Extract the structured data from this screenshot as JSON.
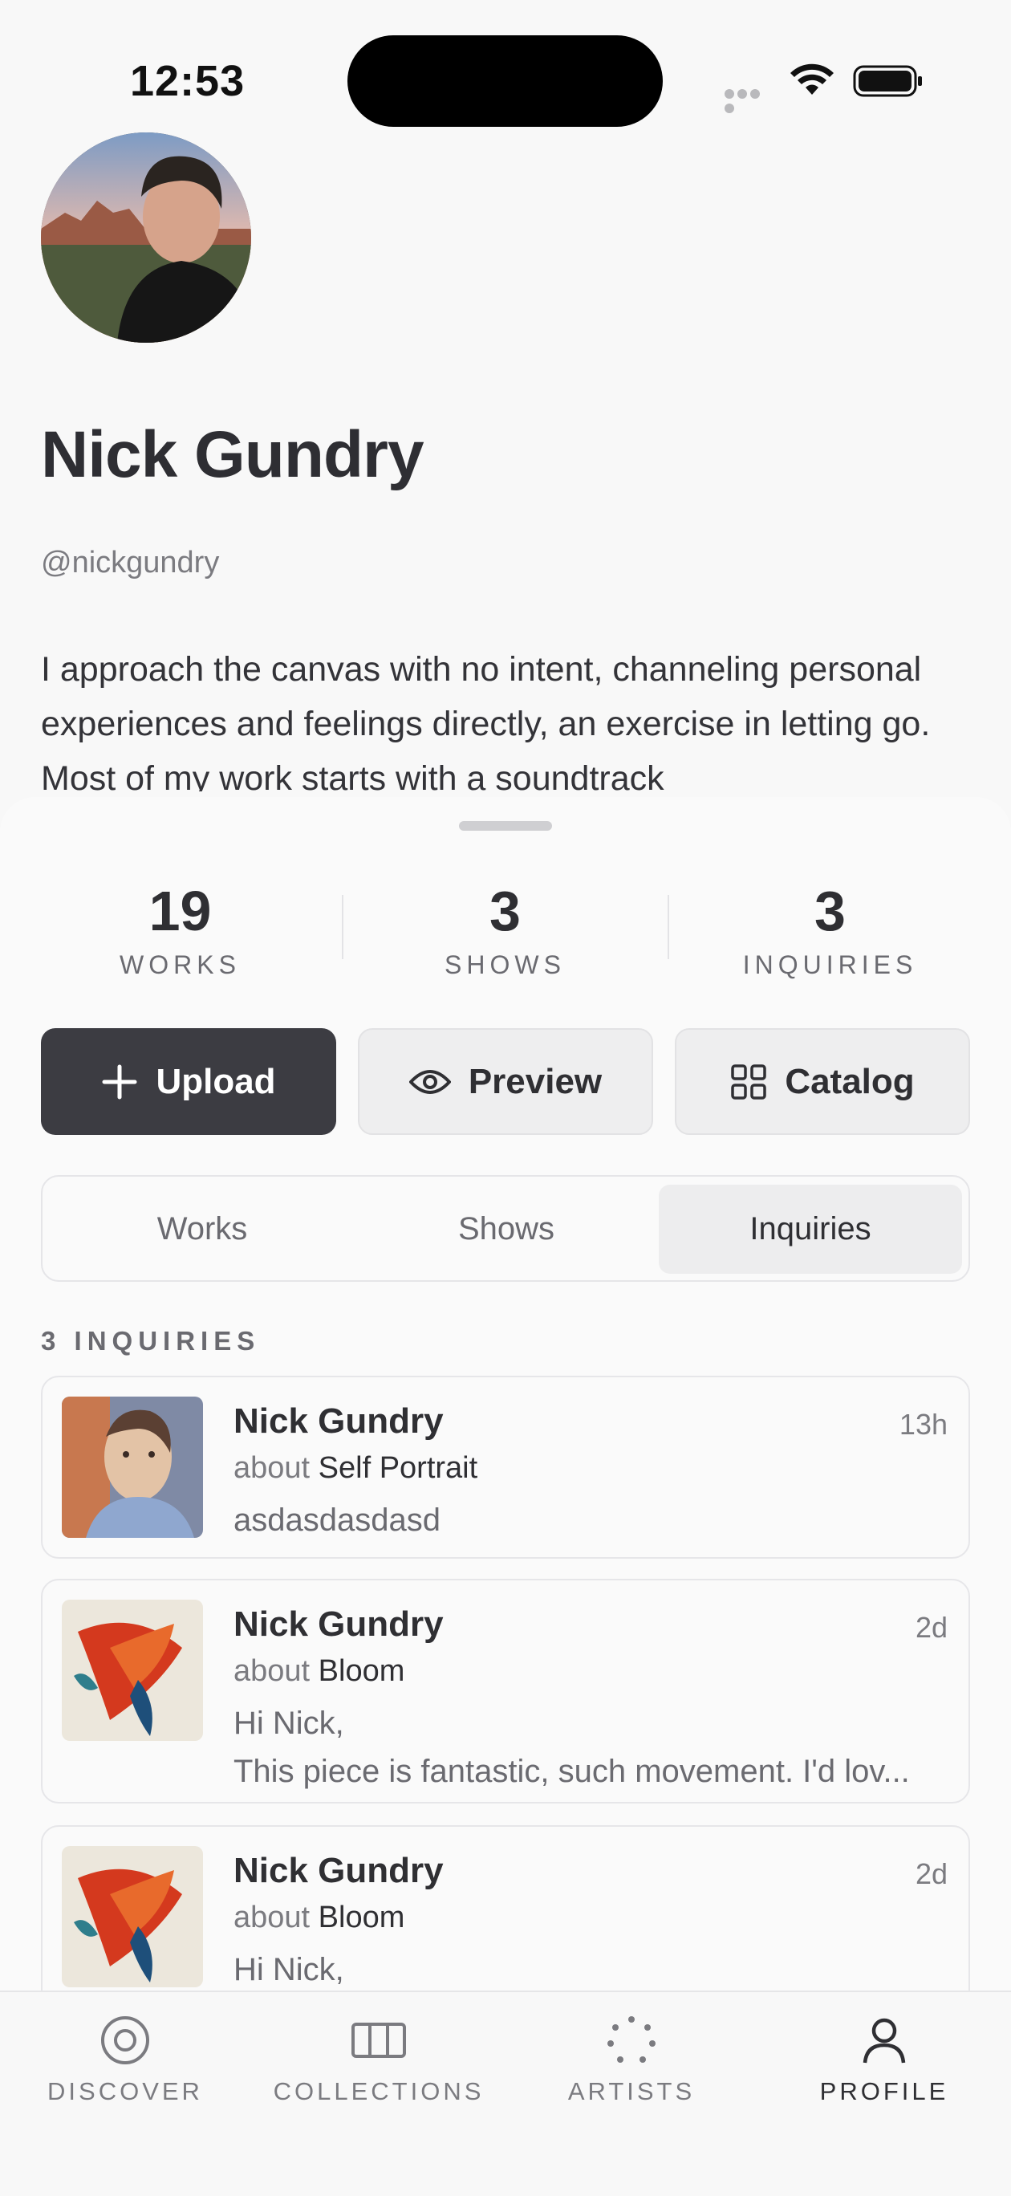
{
  "status_bar": {
    "time": "12:53"
  },
  "profile": {
    "name": "Nick Gundry",
    "handle": "@nickgundry",
    "bio": "I approach the canvas with no intent, channeling personal experiences and feelings directly, an exercise in letting go. Most of my work starts with a soundtrack"
  },
  "stats": [
    {
      "value": "19",
      "label": "WORKS"
    },
    {
      "value": "3",
      "label": "SHOWS"
    },
    {
      "value": "3",
      "label": "INQUIRIES"
    }
  ],
  "actions": {
    "upload": "Upload",
    "preview": "Preview",
    "catalog": "Catalog"
  },
  "segments": {
    "works": "Works",
    "shows": "Shows",
    "inquiries": "Inquiries",
    "active": "Inquiries"
  },
  "section_label": "3 INQUIRIES",
  "about_prefix": "about",
  "inquiries": [
    {
      "sender": "Nick Gundry",
      "time": "13h",
      "artwork": "Self Portrait",
      "message": "asdasdasdasd",
      "message2": ""
    },
    {
      "sender": "Nick Gundry",
      "time": "2d",
      "artwork": "Bloom",
      "message": "Hi Nick,",
      "message2": "This piece is fantastic, such movement. I'd lov..."
    },
    {
      "sender": "Nick Gundry",
      "time": "2d",
      "artwork": "Bloom",
      "message": "Hi Nick,",
      "message2": ""
    }
  ],
  "tabbar": {
    "discover": "DISCOVER",
    "collections": "COLLECTIONS",
    "artists": "ARTISTS",
    "profile": "PROFILE",
    "active": "PROFILE"
  },
  "colors": {
    "primary_button": "#3c3c42",
    "background": "#f8f8f8",
    "text": "#2f2f33",
    "muted_text": "#7b7b80"
  }
}
